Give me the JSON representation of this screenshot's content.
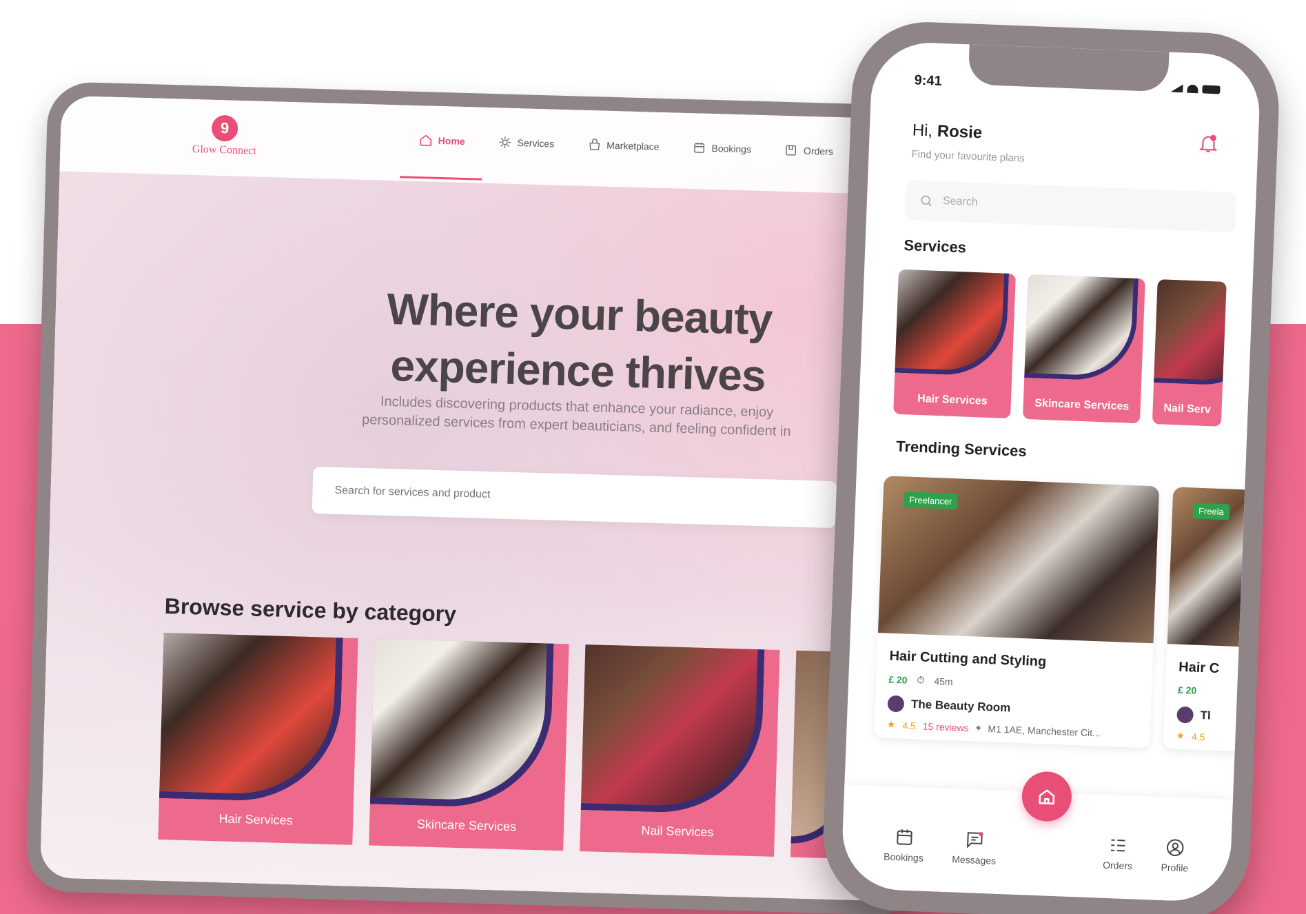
{
  "colors": {
    "accent": "#e94e77",
    "band": "#ee6a8c",
    "freelancer": "#2fa04b"
  },
  "tablet": {
    "logo": {
      "badge": "9",
      "name": "Glow Connect"
    },
    "nav": [
      {
        "label": "Home",
        "icon": "home-icon",
        "active": true
      },
      {
        "label": "Services",
        "icon": "services-icon"
      },
      {
        "label": "Marketplace",
        "icon": "marketplace-icon"
      },
      {
        "label": "Bookings",
        "icon": "calendar-icon"
      },
      {
        "label": "Orders",
        "icon": "orders-icon"
      }
    ],
    "hero": {
      "title_line1": "Where your beauty",
      "title_line2": "experience thrives",
      "subtitle_line1": "Includes discovering products that enhance your radiance, enjoy",
      "subtitle_line2": "personalized services from expert beauticians, and feeling confident in"
    },
    "search_placeholder": "Search for services and product",
    "browse_title": "Browse service by category",
    "categories": [
      {
        "label": "Hair Services"
      },
      {
        "label": "Skincare Services"
      },
      {
        "label": "Nail Services"
      }
    ]
  },
  "phone": {
    "time": "9:41",
    "greeting_prefix": "Hi, ",
    "user_name": "Rosie",
    "subtitle": "Find your favourite plans",
    "search_placeholder": "Search",
    "services_title": "Services",
    "services": [
      {
        "label": "Hair Services"
      },
      {
        "label": "Skincare Services"
      },
      {
        "label": "Nail Serv"
      }
    ],
    "trending_title": "Trending Services",
    "trending": [
      {
        "badge": "Freelancer",
        "title": "Hair Cutting and Styling",
        "price": "£ 20",
        "duration": "45m",
        "shop": "The Beauty Room",
        "rating": "4.5",
        "reviews": "15 reviews",
        "location": "M1 1AE, Manchester Cit..."
      },
      {
        "badge": "Freela",
        "title": "Hair C",
        "price": "£ 20",
        "duration": "",
        "shop": "Tl",
        "rating": "4.5",
        "reviews": "",
        "location": ""
      }
    ],
    "tabs": [
      {
        "label": "Bookings",
        "icon": "calendar-icon"
      },
      {
        "label": "Messages",
        "icon": "messages-icon"
      },
      {
        "label": "Orders",
        "icon": "orders-icon"
      },
      {
        "label": "Profile",
        "icon": "profile-icon"
      }
    ]
  }
}
